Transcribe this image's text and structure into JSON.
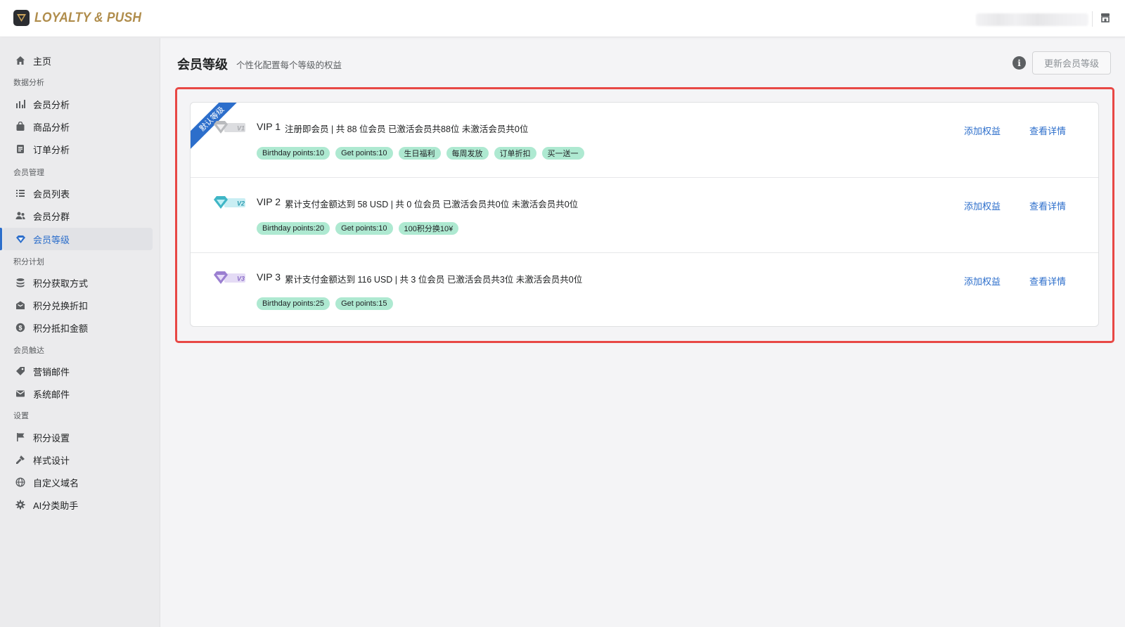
{
  "header": {
    "logo_text": "LOYALTY & PUSH",
    "user_name_redacted": ""
  },
  "sidebar": {
    "home": "主页",
    "sections": {
      "analytics": "数据分析",
      "members": "会员管理",
      "points": "积分计划",
      "reach": "会员触达",
      "settings": "设置"
    },
    "items": [
      {
        "label": "会员分析",
        "icon": "bar-chart-icon"
      },
      {
        "label": "商品分析",
        "icon": "bag-icon"
      },
      {
        "label": "订单分析",
        "icon": "document-icon"
      },
      {
        "label": "会员列表",
        "icon": "list-icon"
      },
      {
        "label": "会员分群",
        "icon": "users-icon"
      },
      {
        "label": "会员等级",
        "icon": "diamond-icon",
        "active": true
      },
      {
        "label": "积分获取方式",
        "icon": "stack-icon"
      },
      {
        "label": "积分兑换折扣",
        "icon": "envelope-open-icon"
      },
      {
        "label": "积分抵扣金额",
        "icon": "dollar-icon"
      },
      {
        "label": "营销邮件",
        "icon": "tag-icon"
      },
      {
        "label": "系统邮件",
        "icon": "mail-icon"
      },
      {
        "label": "积分设置",
        "icon": "flag-icon"
      },
      {
        "label": "样式设计",
        "icon": "paintbrush-icon"
      },
      {
        "label": "自定义域名",
        "icon": "globe-icon"
      },
      {
        "label": "AI分类助手",
        "icon": "gear-icon"
      }
    ]
  },
  "page": {
    "title": "会员等级",
    "subtitle": "个性化配置每个等级的权益",
    "update_button": "更新会员等级"
  },
  "levels": [
    {
      "name": "VIP 1",
      "badge": "V1",
      "ribbon": "默认等级",
      "description": "注册即会员  |  共 88 位会员  已激活会员共88位  未激活会员共0位",
      "tags": [
        "Birthday points:10",
        "Get points:10",
        "生日福利",
        "每周发放",
        "订单折扣",
        "买一送一"
      ],
      "add_link": "添加权益",
      "view_link": "查看详情",
      "color": "#b9bbbe"
    },
    {
      "name": "VIP 2",
      "badge": "V2",
      "description": "累计支付金额达到 58 USD  |  共 0 位会员  已激活会员共0位  未激活会员共0位",
      "tags": [
        "Birthday points:20",
        "Get points:10",
        "100积分换10¥"
      ],
      "add_link": "添加权益",
      "view_link": "查看详情",
      "color": "#3fb6c6"
    },
    {
      "name": "VIP 3",
      "badge": "V3",
      "description": "累计支付金额达到 116 USD  |  共 3 位会员  已激活会员共3位  未激活会员共0位",
      "tags": [
        "Birthday points:25",
        "Get points:15"
      ],
      "add_link": "添加权益",
      "view_link": "查看详情",
      "color": "#9b7fd1"
    }
  ],
  "colors": {
    "accent": "#2c6ecb",
    "tag_bg": "#aee9d1",
    "highlight": "#e84845",
    "logo_gold": "#b08d4c"
  }
}
